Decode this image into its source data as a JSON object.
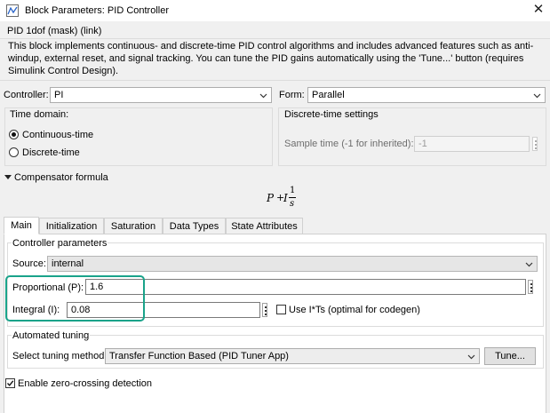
{
  "window": {
    "title": "Block Parameters: PID Controller"
  },
  "mask": {
    "title": "PID 1dof (mask) (link)",
    "description": "This block implements continuous- and discrete-time PID control algorithms and includes advanced features such as anti-windup, external reset, and signal tracking. You can tune the PID gains automatically using the 'Tune...' button (requires Simulink Control Design)."
  },
  "controller": {
    "label": "Controller:",
    "value": "PI"
  },
  "form": {
    "label": "Form:",
    "value": "Parallel"
  },
  "time_domain": {
    "label": "Time domain:",
    "options": [
      {
        "label": "Continuous-time",
        "selected": true
      },
      {
        "label": "Discrete-time",
        "selected": false
      }
    ]
  },
  "discrete_settings": {
    "label": "Discrete-time settings",
    "sample_time_label": "Sample time (-1 for inherited):",
    "sample_time_value": "-1"
  },
  "compensator": {
    "label": "Compensator formula",
    "formula": {
      "p": "P",
      "plus": "+",
      "i": "I",
      "num": "1",
      "den": "s"
    }
  },
  "tabs": [
    {
      "label": "Main",
      "active": true
    },
    {
      "label": "Initialization",
      "active": false
    },
    {
      "label": "Saturation",
      "active": false
    },
    {
      "label": "Data Types",
      "active": false
    },
    {
      "label": "State Attributes",
      "active": false
    }
  ],
  "controller_params": {
    "label": "Controller parameters",
    "source_label": "Source:",
    "source_value": "internal",
    "proportional_label": "Proportional (P):",
    "proportional_value": "1.6",
    "integral_label": "Integral (I):",
    "integral_value": "0.08",
    "use_its_label": "Use I*Ts (optimal for codegen)",
    "use_its_checked": false
  },
  "automated_tuning": {
    "label": "Automated tuning",
    "method_label": "Select tuning method:",
    "method_value": "Transfer Function Based (PID Tuner App)",
    "tune_button": "Tune..."
  },
  "zero_crossing": {
    "label": "Enable zero-crossing detection",
    "checked": true
  },
  "colors": {
    "highlight": "#1aa38a"
  },
  "icons": {
    "title": "simulink-block-icon",
    "close": "close-icon",
    "dropdown": "chevron-down-icon",
    "menu": "vertical-dots-icon"
  }
}
